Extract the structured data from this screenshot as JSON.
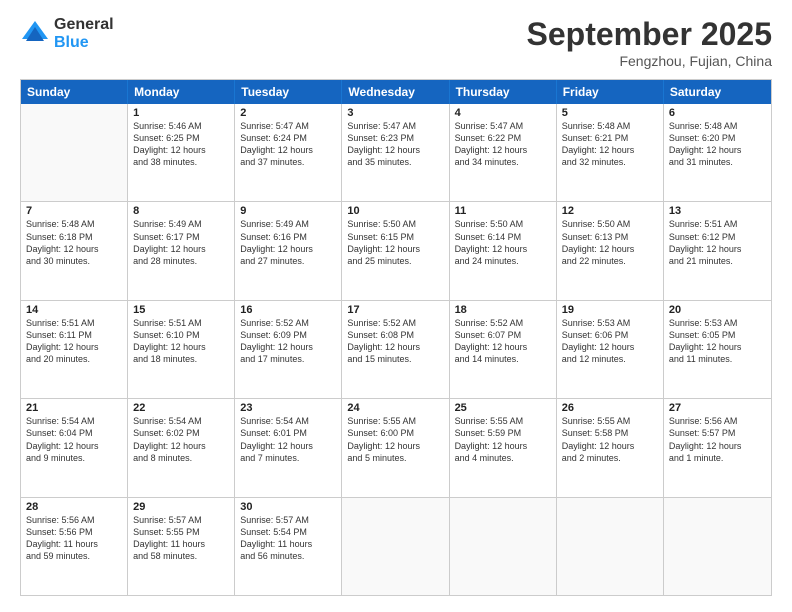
{
  "logo": {
    "general": "General",
    "blue": "Blue"
  },
  "title": {
    "month": "September 2025",
    "location": "Fengzhou, Fujian, China"
  },
  "header_days": [
    "Sunday",
    "Monday",
    "Tuesday",
    "Wednesday",
    "Thursday",
    "Friday",
    "Saturday"
  ],
  "weeks": [
    [
      {
        "day": "",
        "info": ""
      },
      {
        "day": "1",
        "info": "Sunrise: 5:46 AM\nSunset: 6:25 PM\nDaylight: 12 hours\nand 38 minutes."
      },
      {
        "day": "2",
        "info": "Sunrise: 5:47 AM\nSunset: 6:24 PM\nDaylight: 12 hours\nand 37 minutes."
      },
      {
        "day": "3",
        "info": "Sunrise: 5:47 AM\nSunset: 6:23 PM\nDaylight: 12 hours\nand 35 minutes."
      },
      {
        "day": "4",
        "info": "Sunrise: 5:47 AM\nSunset: 6:22 PM\nDaylight: 12 hours\nand 34 minutes."
      },
      {
        "day": "5",
        "info": "Sunrise: 5:48 AM\nSunset: 6:21 PM\nDaylight: 12 hours\nand 32 minutes."
      },
      {
        "day": "6",
        "info": "Sunrise: 5:48 AM\nSunset: 6:20 PM\nDaylight: 12 hours\nand 31 minutes."
      }
    ],
    [
      {
        "day": "7",
        "info": "Sunrise: 5:48 AM\nSunset: 6:18 PM\nDaylight: 12 hours\nand 30 minutes."
      },
      {
        "day": "8",
        "info": "Sunrise: 5:49 AM\nSunset: 6:17 PM\nDaylight: 12 hours\nand 28 minutes."
      },
      {
        "day": "9",
        "info": "Sunrise: 5:49 AM\nSunset: 6:16 PM\nDaylight: 12 hours\nand 27 minutes."
      },
      {
        "day": "10",
        "info": "Sunrise: 5:50 AM\nSunset: 6:15 PM\nDaylight: 12 hours\nand 25 minutes."
      },
      {
        "day": "11",
        "info": "Sunrise: 5:50 AM\nSunset: 6:14 PM\nDaylight: 12 hours\nand 24 minutes."
      },
      {
        "day": "12",
        "info": "Sunrise: 5:50 AM\nSunset: 6:13 PM\nDaylight: 12 hours\nand 22 minutes."
      },
      {
        "day": "13",
        "info": "Sunrise: 5:51 AM\nSunset: 6:12 PM\nDaylight: 12 hours\nand 21 minutes."
      }
    ],
    [
      {
        "day": "14",
        "info": "Sunrise: 5:51 AM\nSunset: 6:11 PM\nDaylight: 12 hours\nand 20 minutes."
      },
      {
        "day": "15",
        "info": "Sunrise: 5:51 AM\nSunset: 6:10 PM\nDaylight: 12 hours\nand 18 minutes."
      },
      {
        "day": "16",
        "info": "Sunrise: 5:52 AM\nSunset: 6:09 PM\nDaylight: 12 hours\nand 17 minutes."
      },
      {
        "day": "17",
        "info": "Sunrise: 5:52 AM\nSunset: 6:08 PM\nDaylight: 12 hours\nand 15 minutes."
      },
      {
        "day": "18",
        "info": "Sunrise: 5:52 AM\nSunset: 6:07 PM\nDaylight: 12 hours\nand 14 minutes."
      },
      {
        "day": "19",
        "info": "Sunrise: 5:53 AM\nSunset: 6:06 PM\nDaylight: 12 hours\nand 12 minutes."
      },
      {
        "day": "20",
        "info": "Sunrise: 5:53 AM\nSunset: 6:05 PM\nDaylight: 12 hours\nand 11 minutes."
      }
    ],
    [
      {
        "day": "21",
        "info": "Sunrise: 5:54 AM\nSunset: 6:04 PM\nDaylight: 12 hours\nand 9 minutes."
      },
      {
        "day": "22",
        "info": "Sunrise: 5:54 AM\nSunset: 6:02 PM\nDaylight: 12 hours\nand 8 minutes."
      },
      {
        "day": "23",
        "info": "Sunrise: 5:54 AM\nSunset: 6:01 PM\nDaylight: 12 hours\nand 7 minutes."
      },
      {
        "day": "24",
        "info": "Sunrise: 5:55 AM\nSunset: 6:00 PM\nDaylight: 12 hours\nand 5 minutes."
      },
      {
        "day": "25",
        "info": "Sunrise: 5:55 AM\nSunset: 5:59 PM\nDaylight: 12 hours\nand 4 minutes."
      },
      {
        "day": "26",
        "info": "Sunrise: 5:55 AM\nSunset: 5:58 PM\nDaylight: 12 hours\nand 2 minutes."
      },
      {
        "day": "27",
        "info": "Sunrise: 5:56 AM\nSunset: 5:57 PM\nDaylight: 12 hours\nand 1 minute."
      }
    ],
    [
      {
        "day": "28",
        "info": "Sunrise: 5:56 AM\nSunset: 5:56 PM\nDaylight: 11 hours\nand 59 minutes."
      },
      {
        "day": "29",
        "info": "Sunrise: 5:57 AM\nSunset: 5:55 PM\nDaylight: 11 hours\nand 58 minutes."
      },
      {
        "day": "30",
        "info": "Sunrise: 5:57 AM\nSunset: 5:54 PM\nDaylight: 11 hours\nand 56 minutes."
      },
      {
        "day": "",
        "info": ""
      },
      {
        "day": "",
        "info": ""
      },
      {
        "day": "",
        "info": ""
      },
      {
        "day": "",
        "info": ""
      }
    ]
  ]
}
